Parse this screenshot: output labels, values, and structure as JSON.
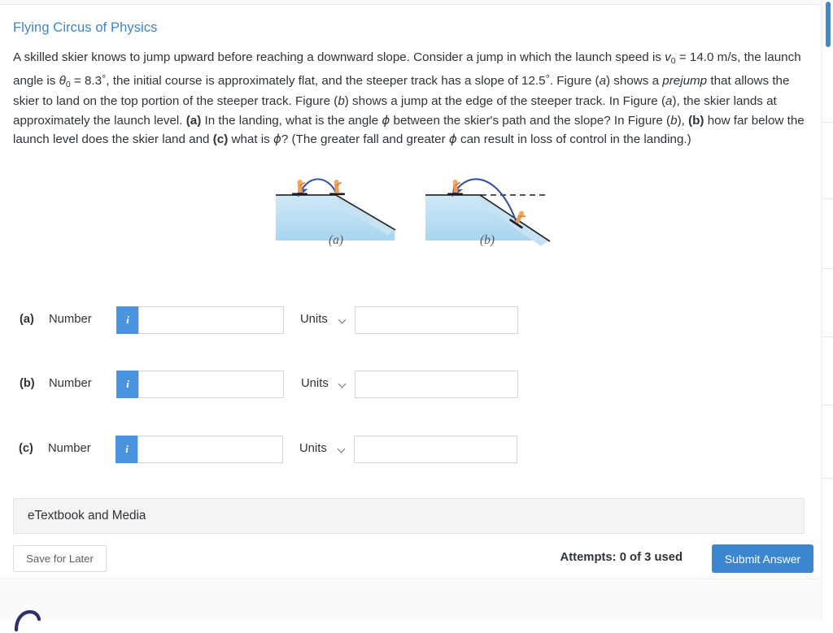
{
  "header": {
    "section_title": "Flying Circus of Physics"
  },
  "problem": {
    "statement_html": "A skilled skier knows to jump upward before reaching a downward slope. Consider a jump in which the launch speed is <span class=\"var\">v</span><sub>0</sub> = 14.0 m/s, the launch angle is <span class=\"var\">&#952;</span><sub>0</sub> = 8.3<span class=\"deg\">&#176;</span>, the initial course is approximately flat, and the steeper track has a slope of 12.5<span class=\"deg\">&#176;</span>. Figure (<i>a</i>) shows a <i>prejump</i> that allows the skier to land on the top portion of the steeper track. Figure (<i>b</i>) shows a jump at the edge of the steeper track. In Figure (<i>a</i>), the skier lands at approximately the launch level. <b>(a)</b> In the landing, what is the angle <span class=\"phi\">&#981;</span> between the skier's path and the slope? In Figure (<i>b</i>), <b>(b)</b> how far below the launch level does the skier land and <b>(c)</b> what is <span class=\"phi\">&#981;</span>? (The greater fall and greater <span class=\"phi\">&#981;</span> can result in loss of control in the landing.)",
    "launch_speed": "14.0 m/s",
    "launch_angle": "8.3°",
    "track_slope": "12.5°"
  },
  "figure": {
    "panel_a_caption": "(a)",
    "panel_b_caption": "(b)",
    "panel_a_alt": "prejump: skier launches before the break in slope and lands near launch level on the top of the steeper track",
    "panel_b_alt": "skier launches at the edge of the steeper track and lands far down the slope, below the dashed launch level"
  },
  "answers": [
    {
      "part_label": "(a)",
      "number_word": "Number",
      "info_glyph": "i",
      "number_value": "",
      "units_word": "Units",
      "units_selected": ""
    },
    {
      "part_label": "(b)",
      "number_word": "Number",
      "info_glyph": "i",
      "number_value": "",
      "units_word": "Units",
      "units_selected": ""
    },
    {
      "part_label": "(c)",
      "number_word": "Number",
      "info_glyph": "i",
      "number_value": "",
      "units_word": "Units",
      "units_selected": ""
    }
  ],
  "etextbook": {
    "label": "eTextbook and Media"
  },
  "footer": {
    "save_label": "Save for Later",
    "attempts_text": "Attempts: 0 of 3 used",
    "submit_label": "Submit Answer"
  },
  "colors": {
    "section_title": "#3d85c6",
    "info_badge": "#4a93de",
    "submit_button": "#3b86cf",
    "scrollbar_thumb": "#4a86c5",
    "figure_snow": "#bfe0f2",
    "figure_trajectory": "#3b4fa8"
  }
}
